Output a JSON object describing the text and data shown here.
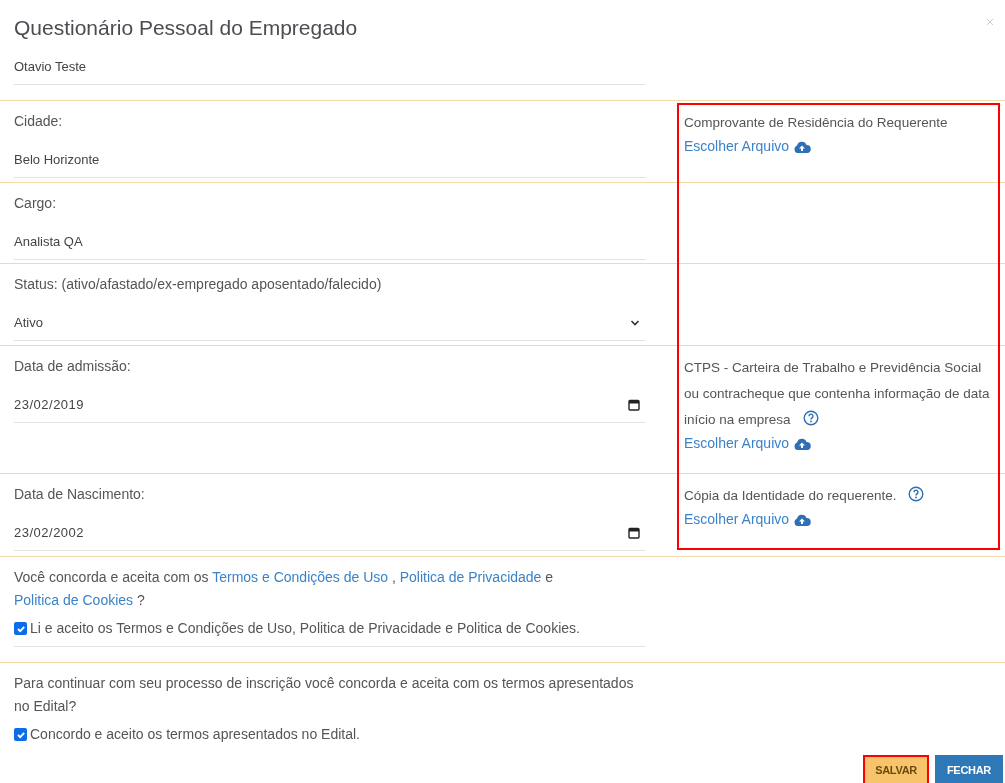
{
  "title": "Questionário Pessoal do Empregado",
  "rows": [
    {
      "field": {
        "kind": "text",
        "value": "Otavio Teste"
      }
    },
    {
      "field": {
        "kind": "text",
        "label": "Cidade:",
        "value": "Belo Horizonte"
      },
      "document": {
        "label": "Comprovante de Residência do Requerente",
        "help": false,
        "link": "Escolher Arquivo"
      }
    },
    {
      "field": {
        "kind": "text",
        "label": "Cargo:",
        "value": "Analista QA"
      }
    },
    {
      "field": {
        "kind": "select",
        "label": "Status: (ativo/afastado/ex-empregado aposentado/falecido)",
        "value": "Ativo"
      }
    },
    {
      "field": {
        "kind": "date",
        "label": "Data de admissão:",
        "value": "23/02/2019"
      },
      "document": {
        "label": "CTPS - Carteira de Trabalho e Previdência Social ou contracheque que contenha informação de data início na empresa",
        "help": true,
        "link": "Escolher Arquivo"
      }
    },
    {
      "field": {
        "kind": "date",
        "label": "Data de Nascimento:",
        "value": "23/02/2002"
      },
      "document": {
        "label": "Cópia da Identidade do requerente.",
        "help": true,
        "link": "Escolher Arquivo"
      }
    }
  ],
  "terms": {
    "question": [
      {
        "text": "Você concorda e aceita com os "
      },
      {
        "text": "Termos e Condições de Uso",
        "link": true
      },
      {
        "text": " , "
      },
      {
        "text": "Politica de Privacidade",
        "link": true
      },
      {
        "text": " e "
      },
      {
        "text": "Politica de Cookies",
        "link": true
      },
      {
        "text": " ?"
      }
    ],
    "checkbox": {
      "label": "Li e aceito os Termos e Condições de Uso, Politica de Privacidade e Politica de Cookies.",
      "checked": true
    }
  },
  "edital": {
    "question": "Para continuar com seu processo de inscrição você concorda e aceita com os termos apresentados no Edital?",
    "checkbox": {
      "label": "Concordo e aceito os termos apresentados no Edital.",
      "checked": true
    }
  },
  "buttons": [
    {
      "label": "SALVAR",
      "kind": "primary",
      "highlighted": true
    },
    {
      "label": "FECHAR",
      "kind": "secondary",
      "highlighted": false
    }
  ]
}
